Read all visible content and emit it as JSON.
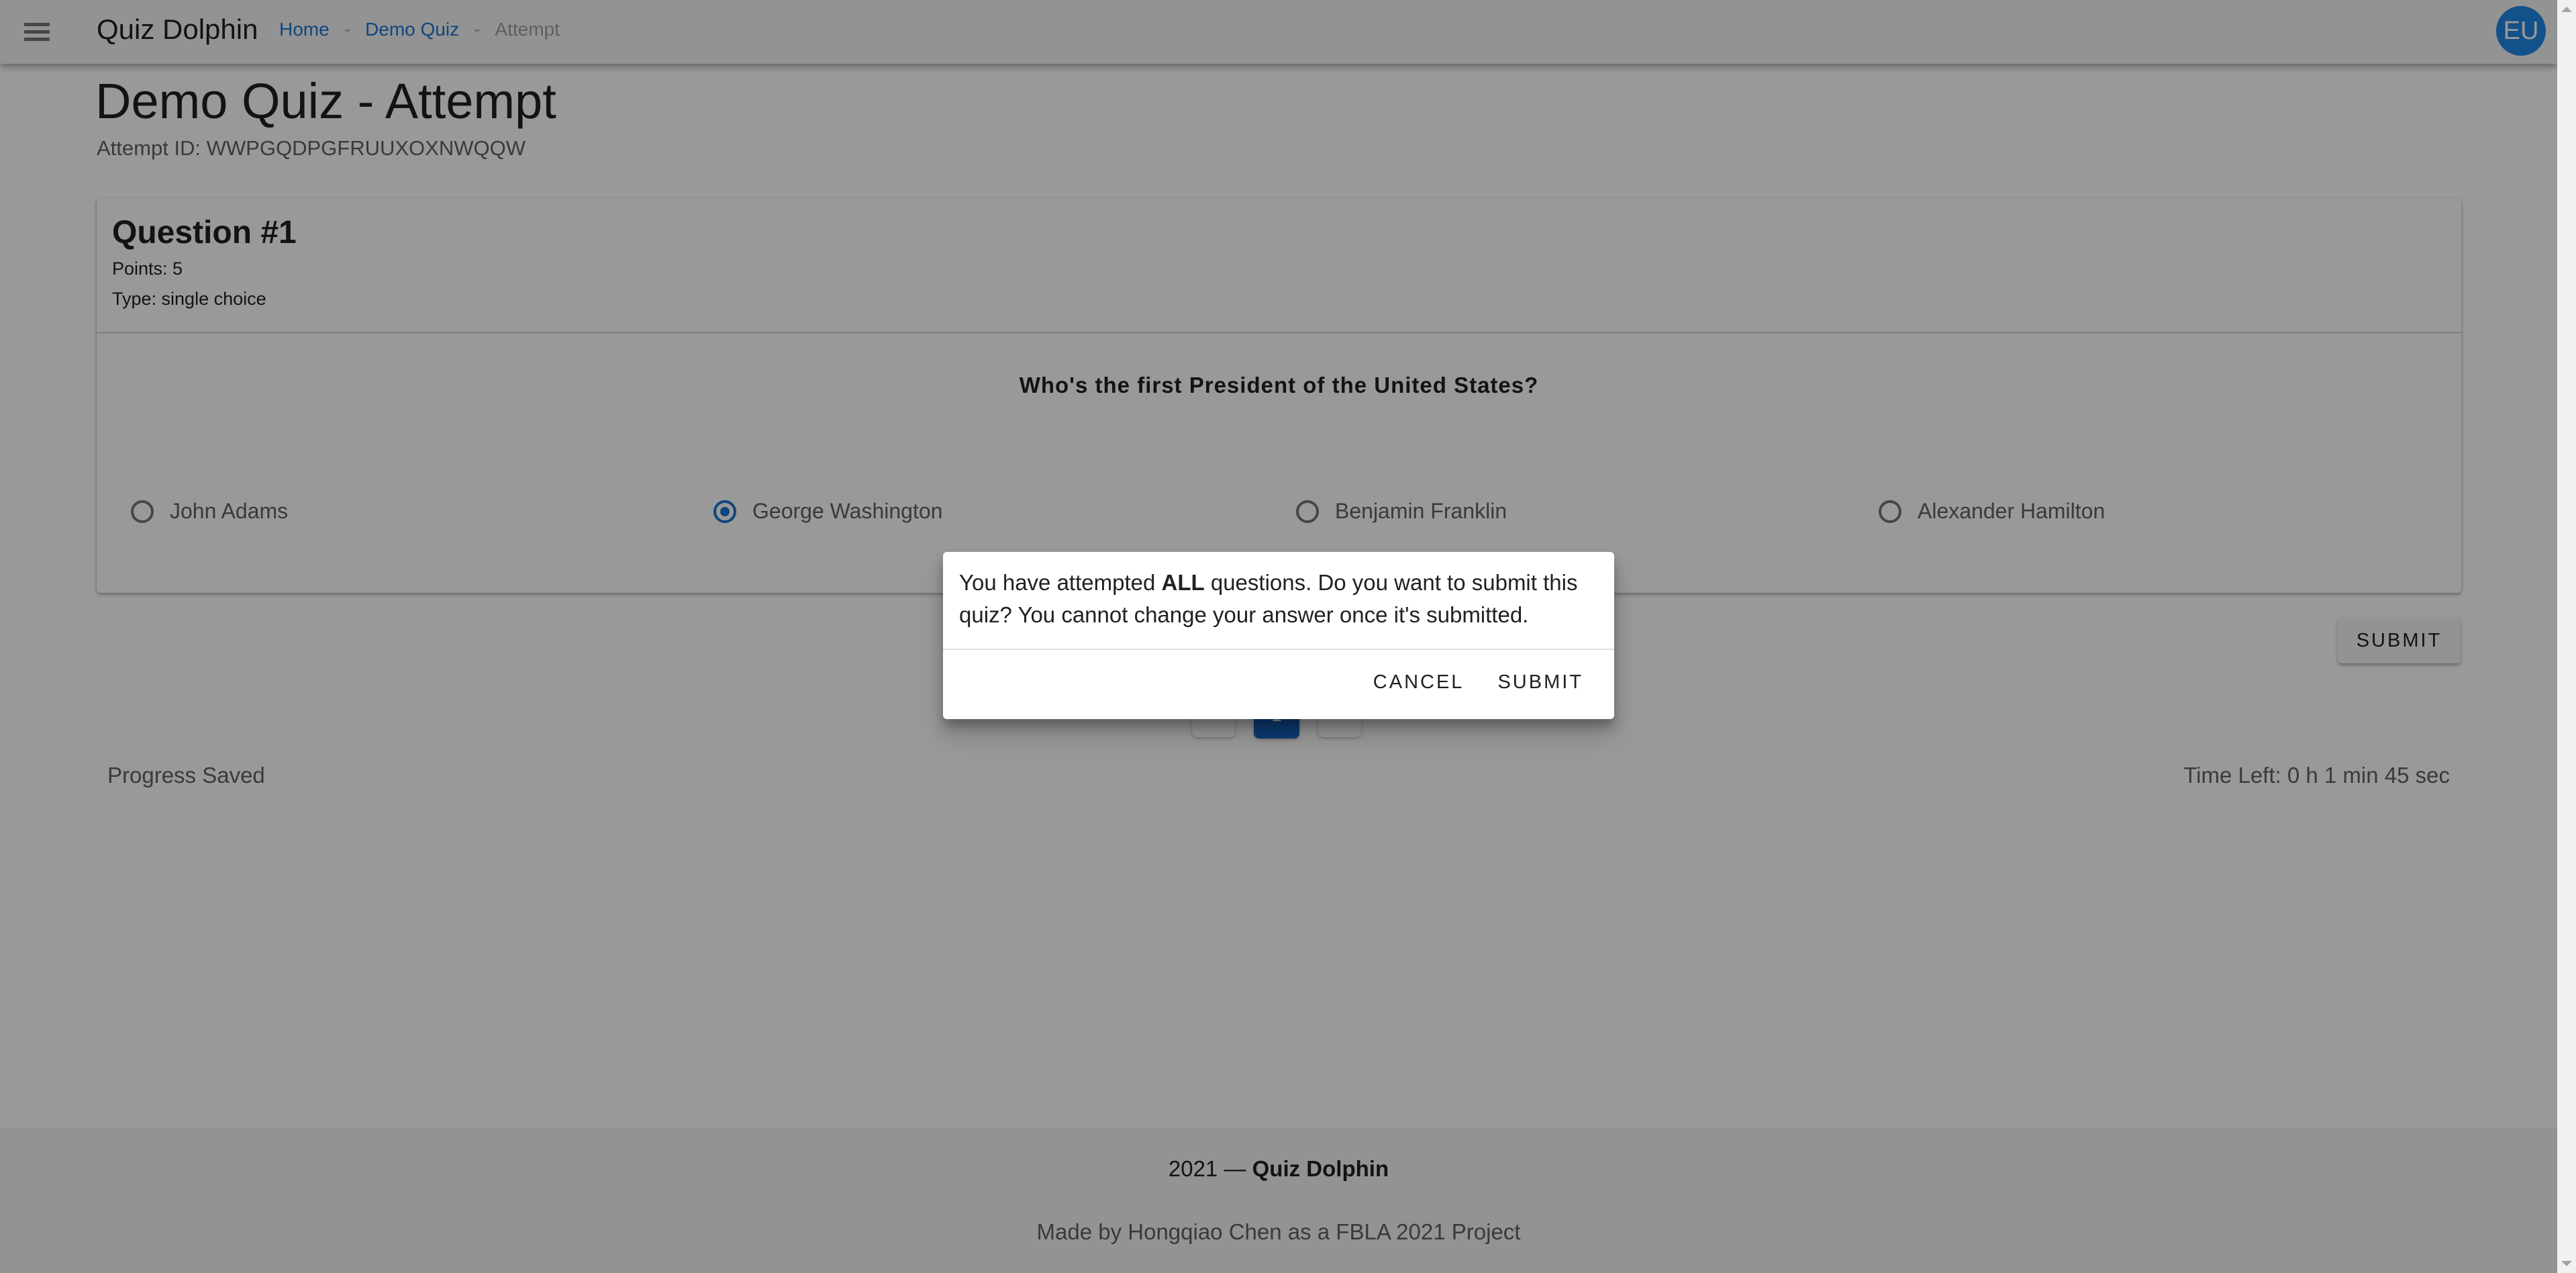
{
  "header": {
    "brand": "Quiz Dolphin",
    "menu_icon": "hamburger-menu-icon",
    "breadcrumbs": [
      {
        "label": "Home",
        "link": true
      },
      {
        "label": "Demo Quiz",
        "link": true
      },
      {
        "label": "Attempt",
        "link": false
      }
    ],
    "breadcrumb_separator": "-",
    "avatar_initials": "EU"
  },
  "page": {
    "title": "Demo Quiz - Attempt",
    "attempt_id": "Attempt ID: WWPGQDPGFRUUXOXNWQQW"
  },
  "question": {
    "title": "Question #1",
    "points": "Points: 5",
    "type": "Type: single choice",
    "text": "Who's the first President of the United States?",
    "options": [
      {
        "label": "John Adams",
        "selected": false
      },
      {
        "label": "George Washington",
        "selected": true
      },
      {
        "label": "Benjamin Franklin",
        "selected": false
      },
      {
        "label": "Alexander Hamilton",
        "selected": false
      }
    ]
  },
  "actions": {
    "submit_label": "SUBMIT"
  },
  "pagination": {
    "prev_icon": "chevron-left-icon",
    "current_page": "1",
    "next_icon": "chevron-right-icon"
  },
  "status": {
    "progress": "Progress Saved",
    "time_left": "Time Left: 0 h 1 min 45 sec"
  },
  "footer": {
    "year": "2021 —",
    "brand": "Quiz Dolphin",
    "credit": "Made by Hongqiao Chen as a FBLA 2021 Project"
  },
  "dialog": {
    "text_before": "You have attempted ",
    "text_bold": "ALL",
    "text_after": " questions. Do you want to submit this quiz? You cannot change your answer once it's submitted.",
    "cancel_label": "CANCEL",
    "submit_label": "SUBMIT"
  },
  "colors": {
    "accent": "#1976d2",
    "avatar": "#1e88e5",
    "active_page": "#1565c0",
    "scrim": "rgba(0,0,0,0.4)"
  }
}
